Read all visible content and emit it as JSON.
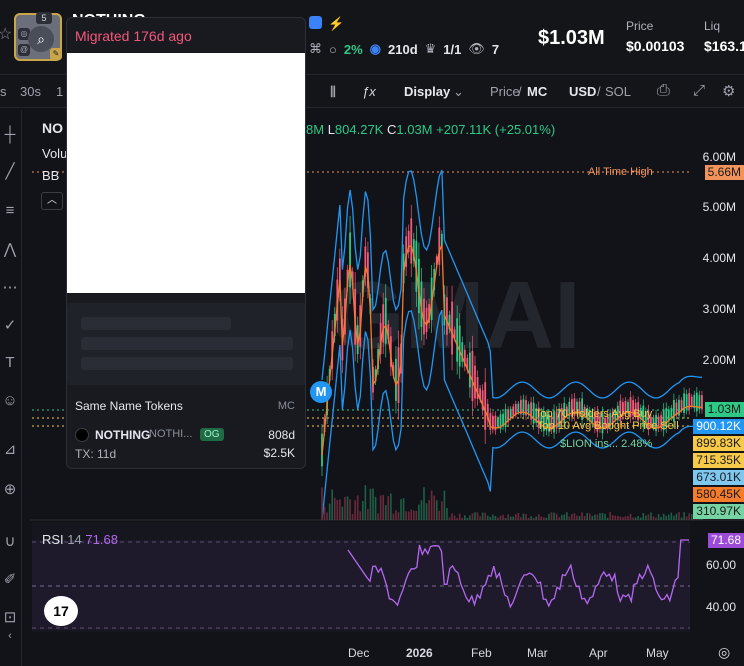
{
  "header": {
    "token_name": "NOTHING",
    "badge_count": "5",
    "holders_pct": "2%",
    "age": "210d",
    "ratio": "1/1",
    "watchers": "7",
    "market_cap": "$1.03M",
    "price_label": "Price",
    "price_value": "$0.00103",
    "liq_label": "Liq",
    "liq_value": "$163.1"
  },
  "toolbar": {
    "tf_s": "s",
    "tf_30s": "30s",
    "tf_1": "1",
    "display": "Display",
    "price": "Price",
    "sep1": "/",
    "mc": "MC",
    "usd": "USD",
    "sep2": "/",
    "sol": "SOL"
  },
  "chart_legend": {
    "symbol": "NO",
    "volume": "Volu",
    "bb": "BB",
    "ohlc_partial": "8M",
    "l_label": "L",
    "l_value": "804.27K",
    "c_label": "C",
    "c_value": "1.03M",
    "change": "+207.11K (+25.01%)",
    "watermark": "GMAI"
  },
  "price_axis": [
    "6.00M",
    "5.00M",
    "4.00M",
    "3.00M",
    "2.00M"
  ],
  "price_tags": [
    {
      "text": "5.66M",
      "bg": "#f2935c",
      "fg": "#1a1a1a"
    },
    {
      "text": "1.03M",
      "bg": "#2ec986",
      "fg": "#1a1a1a"
    },
    {
      "text": "900.12K",
      "bg": "#2196f3",
      "fg": "#ffffff"
    },
    {
      "text": "899.83K",
      "bg": "#f7c948",
      "fg": "#1a1a1a"
    },
    {
      "text": "715.35K",
      "bg": "#f7c948",
      "fg": "#1a1a1a"
    },
    {
      "text": "673.01K",
      "bg": "#7ec8f0",
      "fg": "#1a1a1a"
    },
    {
      "text": "580.45K",
      "bg": "#f57c2a",
      "fg": "#1a1a1a"
    },
    {
      "text": "310.97K",
      "bg": "#76d4a4",
      "fg": "#1a1a1a"
    }
  ],
  "annotations": {
    "ath": "All Time High",
    "top70": "Top 70 Holders Avg Buy",
    "avg_bought": "Top 10 Avg Bought Price Sell",
    "lion": "$LION ins... 2.48%"
  },
  "rsi": {
    "label": "RSI",
    "period": "14",
    "value": "71.68",
    "axis": [
      "60.00",
      "40.00"
    ],
    "tag": "71.68"
  },
  "x_axis": [
    "Dec",
    "2026",
    "Feb",
    "Mar",
    "Apr",
    "May"
  ],
  "popup": {
    "title": "Migrated 176d ago",
    "same_name_title": "Same Name Tokens",
    "mc_header": "MC",
    "row_name": "NOTHING",
    "row_symbol": "NOTHI...",
    "row_badge": "OG",
    "row_age": "808d",
    "row_tx": "TX: 11d",
    "row_mc": "$2.5K"
  },
  "chart_data": {
    "type": "candlestick",
    "y_unit": "market cap (USD)",
    "ylim": [
      0,
      6000000
    ],
    "x": [
      "Dec",
      "2026",
      "Feb",
      "Mar",
      "Apr",
      "May"
    ],
    "last_close": 1030000,
    "low": 804270,
    "change": 207110,
    "change_pct": 25.01,
    "all_time_high": 5660000,
    "reference_levels": [
      5660000,
      1030000,
      900120,
      899830,
      715350,
      673010,
      580450,
      310970
    ],
    "rsi_last": 71.68
  }
}
